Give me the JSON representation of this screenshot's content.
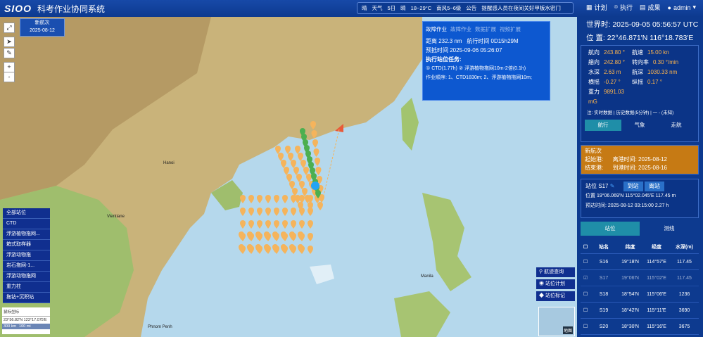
{
  "header": {
    "logo": "SIOO",
    "title": "科考作业协同系统",
    "notice": {
      "a": "晴",
      "b": "天气",
      "c": "5日",
      "d": "晴",
      "e": "18~29°C",
      "f": "南风5~6级",
      "g": "公告",
      "h": "提醒感人员在夜间关好甲板水密门"
    },
    "nav": [
      {
        "icon": "calendar-icon",
        "label": "计划"
      },
      {
        "icon": "location-pin-icon",
        "label": "执行"
      },
      {
        "icon": "table-icon",
        "label": "成果"
      },
      {
        "icon": "user-icon",
        "label": "admin"
      }
    ]
  },
  "map": {
    "cruise_label": "新航次",
    "cruise_date": "2025-08-12",
    "labels": {
      "hanoi": "Hanoi",
      "vientiane": "Vientiane",
      "manila": "Manila",
      "phnom_penh": "Phnom Penh"
    },
    "zoom_plus": "+",
    "zoom_minus": "-",
    "coord_label": "鼠标坐标",
    "coord_value": "23°56.82'N 123°17.075'E",
    "scale": [
      "300 km",
      "100 mi"
    ],
    "minimap_label": "地图"
  },
  "task_panel": {
    "tabs": [
      "故障作业",
      "故障作业",
      "数据扩展",
      "视频扩展"
    ],
    "distance_label": "距离",
    "distance_value": "232.3 nm",
    "sail_label": "航行时间",
    "sail_value": "0D15h29M",
    "eta_label": "预抵时间",
    "eta_value": "2025-09-06 05:26:07",
    "next_label": "执行站位任务:",
    "task1": "CTD(1.77h)",
    "task2": "浮游植物拖网10m-2倍(0.1h)",
    "order_label": "作业顺序:",
    "order_value": "1、CTD1830m; 2、浮游植物拖网10m;"
  },
  "legend": [
    "全部站位",
    "CTD",
    "浮游植物拖网...",
    "箱式取样器",
    "浮游动物拖",
    "岩石拖网-1...",
    "浮游动物拖网",
    "重力柱",
    "拖钻+沉积站"
  ],
  "map_buttons": [
    "航迹查询",
    "站位计划",
    "站位标记"
  ],
  "right": {
    "utc_label": "世界时:",
    "utc_value": "2025-09-05 05:56:57 UTC",
    "pos_label": "位 置:",
    "pos_value": "22°46.871'N 116°18.783'E",
    "nav_grid": [
      [
        "航向",
        "243.80 °",
        "航速",
        "15.00 kn"
      ],
      [
        "艏向",
        "242.80 °",
        "转向率",
        "0.30 °/min"
      ],
      [
        "水深",
        "2.63 m",
        "航深",
        "1030.33 nm"
      ],
      [
        "横摇",
        "-0.27 °",
        "纵摇",
        "0.17 °"
      ],
      [
        "重力",
        "9891.03 mG",
        "",
        ""
      ]
    ],
    "note": "注: 实时数据 | 历史数据(5分钟) | 一 - (未知)",
    "nav_tabs": [
      "航行",
      "气象",
      "走航"
    ],
    "cruise": {
      "name": "新航次",
      "start_port_label": "起始港:",
      "start_time_label": "离港时间:",
      "start_time": "2025-08-12",
      "end_port_label": "结束港:",
      "end_time_label": "到港时间:",
      "end_time": "2025-08-16"
    },
    "station": {
      "label": "站位",
      "value": "S17",
      "btn1": "到站",
      "btn2": "离站",
      "pos_label": "位置",
      "pos_value": "19°06.069'N 115°02.045'E 117.45 m",
      "arrive_label": "预达时间:",
      "arrive_value": "2025-08-12 03:15:00 2.27 h"
    },
    "list_tabs": [
      "站位",
      "测线"
    ],
    "table_headers": [
      "站名",
      "纬度",
      "经度",
      "水深(m)"
    ],
    "table_rows": [
      [
        "S16",
        "19°18'N",
        "114°57'E",
        "117.45"
      ],
      [
        "S17",
        "19°06'N",
        "115°02'E",
        "117.45"
      ],
      [
        "S18",
        "18°54'N",
        "115°06'E",
        "1236"
      ],
      [
        "S19",
        "18°42'N",
        "115°11'E",
        "3690"
      ],
      [
        "S20",
        "18°30'N",
        "115°16'E",
        "3675"
      ]
    ]
  }
}
